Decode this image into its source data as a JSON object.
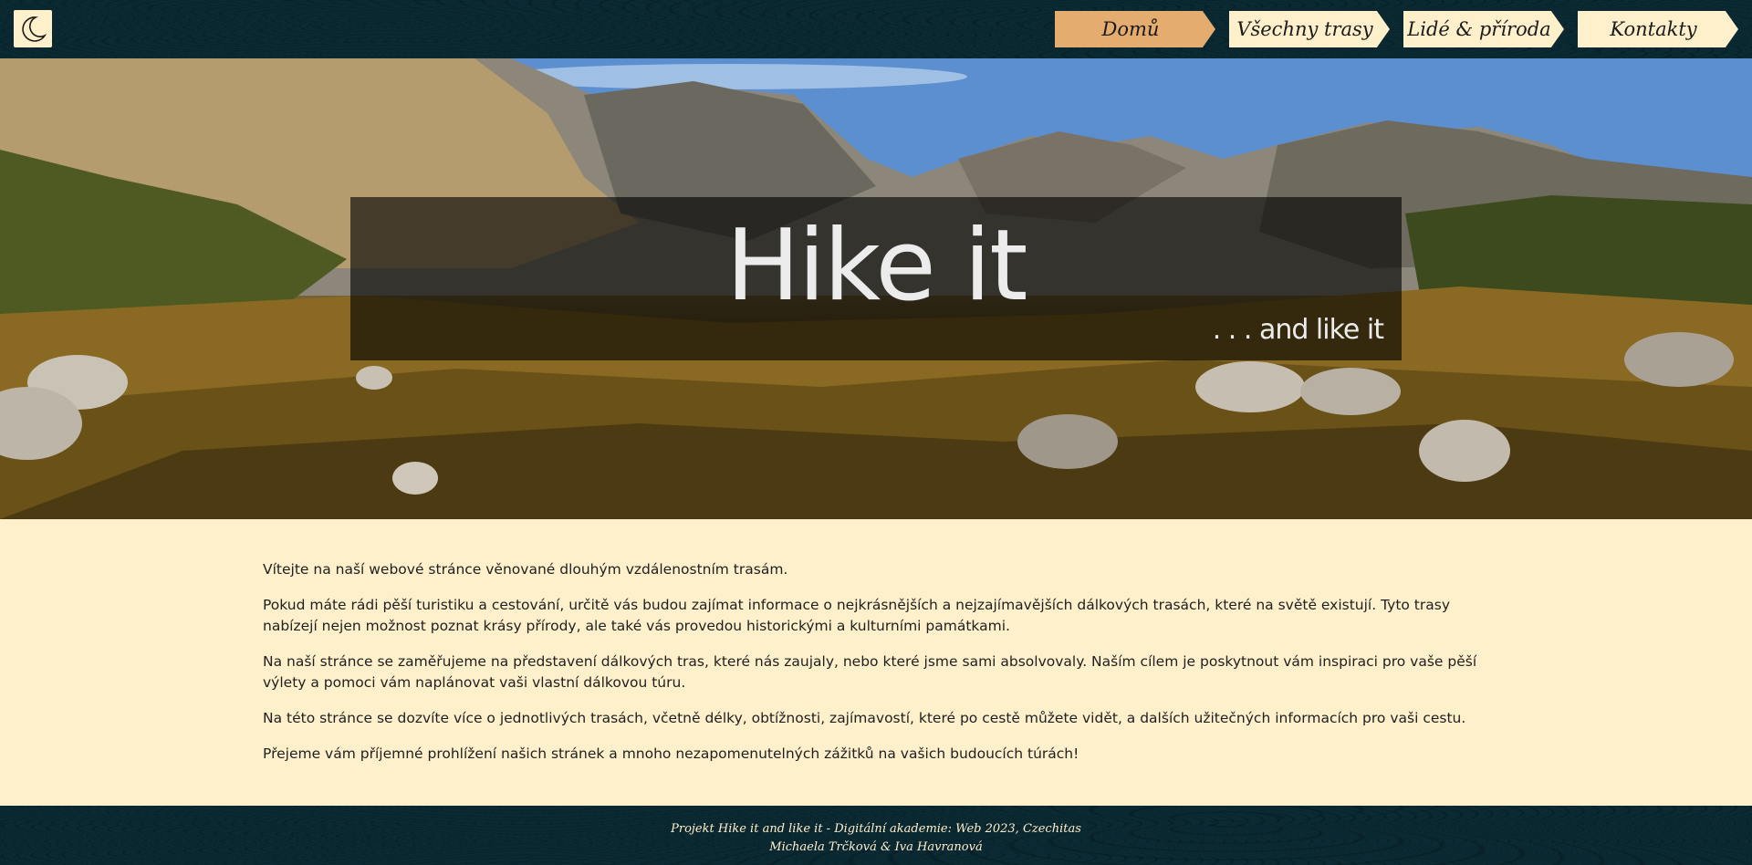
{
  "header": {
    "logo_icon": "crescent-moon-icon",
    "nav": [
      {
        "label": "Domů",
        "active": true
      },
      {
        "label": "Všechny trasy",
        "active": false
      },
      {
        "label": "Lidé & příroda",
        "active": false
      },
      {
        "label": "Kontakty",
        "active": false
      }
    ]
  },
  "hero": {
    "title": "Hike it",
    "subtitle": ". . . and like it"
  },
  "content": {
    "paragraphs": [
      "Vítejte na naší webové stránce věnované dlouhým vzdálenostním trasám.",
      "Pokud máte rádi pěší turistiku a cestování, určitě vás budou zajímat informace o nejkrásnějších a nejzajímavějších dálkových trasách, které na světě existují. Tyto trasy nabízejí nejen možnost poznat krásy přírody, ale také vás provedou historickými a kulturními památkami.",
      "Na naší stránce se zaměřujeme na představení dálkových tras, které nás zaujaly, nebo které jsme sami absolvovaly. Naším cílem je poskytnout vám inspiraci pro vaše pěší výlety a pomoci vám naplánovat vaši vlastní dálkovou túru.",
      "Na této stránce se dozvíte více o jednotlivých trasách, včetně délky, obtížnosti, zajímavostí, které po cestě můžete vidět, a dalších užitečných informacích pro vaši cestu.",
      "Přejeme vám příjemné prohlížení našich stránek a mnoho nezapomenutelných zážitků na vašich budoucích túrách!"
    ]
  },
  "footer": {
    "line1": "Projekt Hike it and like it - Digitální akademie: Web 2023, Czechitas",
    "line2": "Michaela Trčková & Iva Havranová"
  },
  "colors": {
    "header_bg": "#0b2a33",
    "cream": "#fff0cc",
    "active_nav": "#e4ac6e"
  }
}
